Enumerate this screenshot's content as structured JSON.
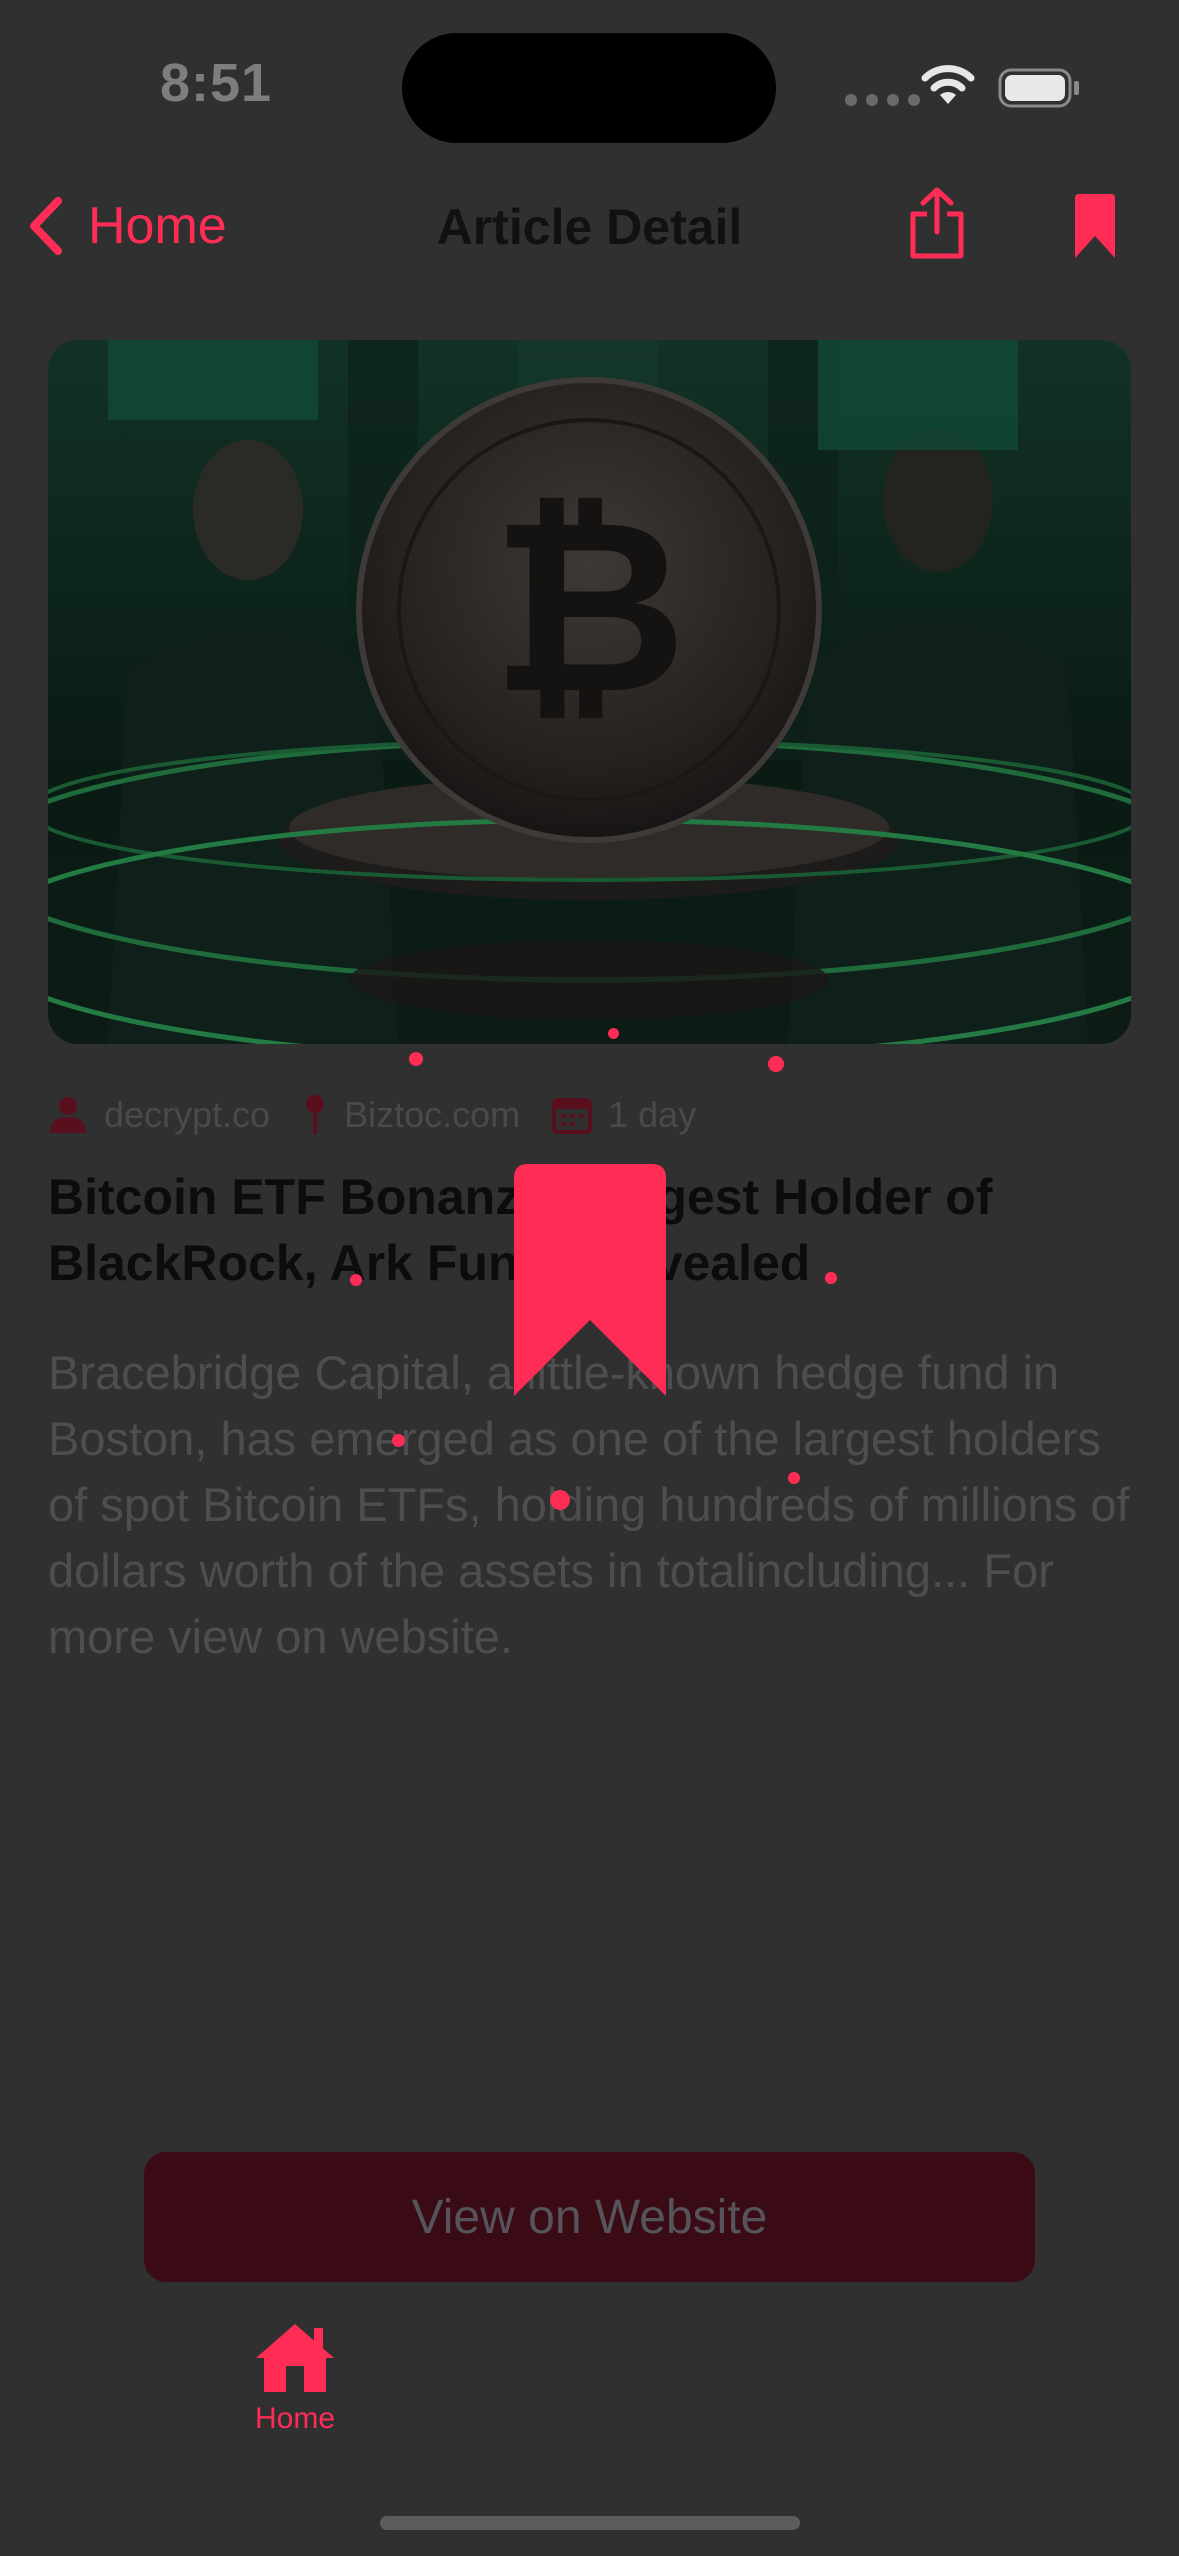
{
  "status_bar": {
    "time": "8:51"
  },
  "nav": {
    "back_label": "Home",
    "title": "Article Detail"
  },
  "article": {
    "meta": {
      "author": "decrypt.co",
      "source": "Biztoc.com",
      "date": "1 day"
    },
    "title": "Bitcoin ETF Bonanza: Largest Holder of BlackRock, Ark Funds Revealed",
    "body": "Bracebridge Capital, a little-known hedge fund in Boston, has emerged as one of the largest holders of spot Bitcoin ETFs, holding hundreds of millions of dollars worth of the assets in totalincluding... For more view on website."
  },
  "actions": {
    "view_website": "View on Website"
  },
  "tab_bar": {
    "home_label": "Home"
  },
  "colors": {
    "accent": "#ff2d55",
    "background": "#303031"
  },
  "icons": [
    "chevron-left-icon",
    "share-icon",
    "bookmark-icon",
    "person-icon",
    "pin-icon",
    "calendar-icon",
    "house-icon",
    "wifi-icon",
    "battery-icon"
  ]
}
